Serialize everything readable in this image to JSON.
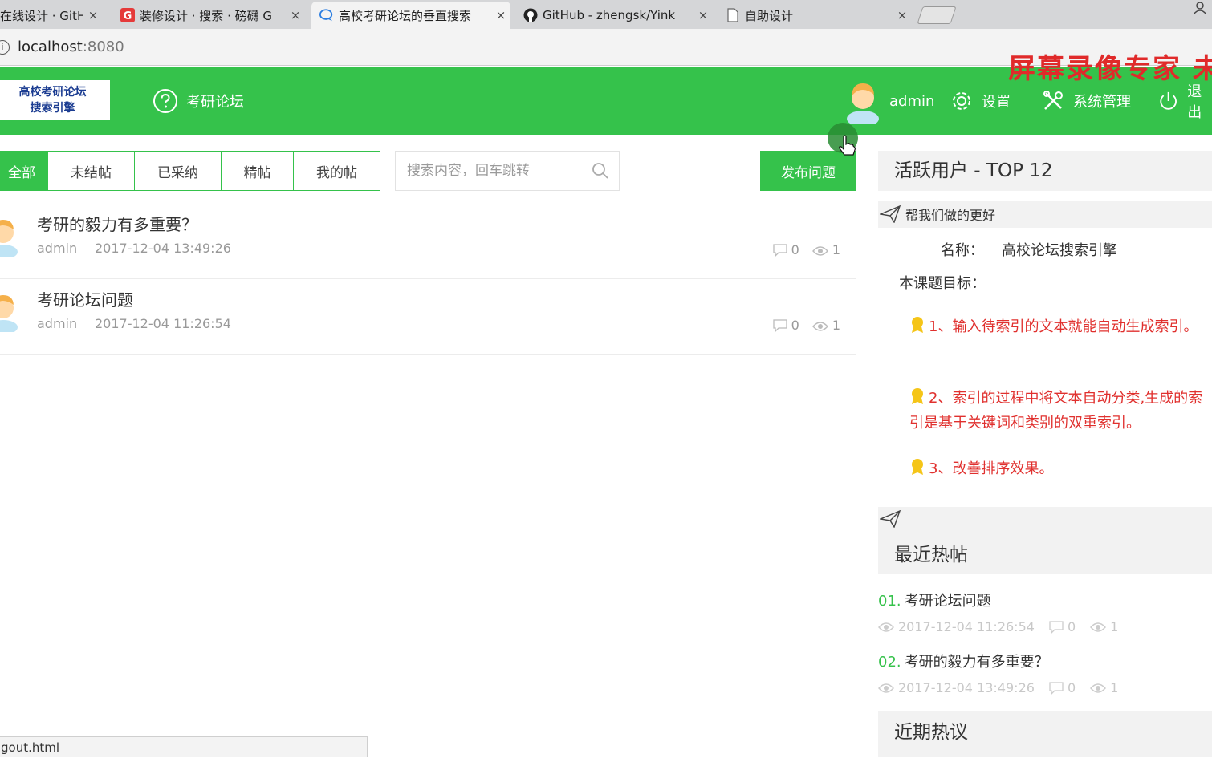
{
  "browser": {
    "tabs": [
      {
        "title": "在线设计 · GitH",
        "icon": "github-icon",
        "active": false
      },
      {
        "title": "装修设计 · 搜索 · 磅礴 G",
        "icon": "search-engine-icon",
        "active": false
      },
      {
        "title": "高校考研论坛的垂直搜索",
        "icon": "chat-bubble-icon",
        "active": true
      },
      {
        "title": "GitHub - zhengsk/Yink",
        "icon": "github-icon",
        "active": false
      },
      {
        "title": "自助设计",
        "icon": "page-icon",
        "active": false
      }
    ],
    "close_glyph": "×",
    "url_host": "localhost",
    "url_port": ":8080",
    "status_text": "gout.html"
  },
  "watermark": "屏幕录像专家  未",
  "header": {
    "logo_line1": "高校考研论坛",
    "logo_line2": "搜索引擎",
    "forum_label": "考研论坛",
    "user_name": "admin",
    "settings_label": "设置",
    "admin_label": "系统管理",
    "logout_label": "退出"
  },
  "filters": {
    "tabs": [
      "全部",
      "未结帖",
      "已采纳",
      "精帖",
      "我的帖"
    ],
    "search_placeholder": "搜索内容，回车跳转",
    "post_button": "发布问题"
  },
  "posts": [
    {
      "title": "考研的毅力有多重要？",
      "author": "admin",
      "time": "2017-12-04 13:49:26",
      "comments": "0",
      "views": "1"
    },
    {
      "title": "考研论坛问题",
      "author": "admin",
      "time": "2017-12-04 11:26:54",
      "comments": "0",
      "views": "1"
    }
  ],
  "sidebar": {
    "active_users_title": "活跃用户 - TOP 12",
    "help_title": "帮我们做的更好",
    "name_label": "名称：",
    "name_value": "高校论坛搜索引擎",
    "goal_label": "本课题目标：",
    "goals": [
      "1、输入待索引的文本就能自动生成索引。",
      "2、索引的过程中将文本自动分类,生成的索引是基于关键词和类别的双重索引。",
      "3、改善排序效果。"
    ],
    "hot_title": "最近热帖",
    "hot_posts": [
      {
        "num": "01.",
        "title": "考研论坛问题",
        "time": "2017-12-04 11:26:54",
        "comments": "0",
        "views": "1"
      },
      {
        "num": "02.",
        "title": "考研的毅力有多重要？",
        "time": "2017-12-04 13:49:26",
        "comments": "0",
        "views": "1"
      }
    ],
    "recent_hot_title": "近期热议"
  }
}
